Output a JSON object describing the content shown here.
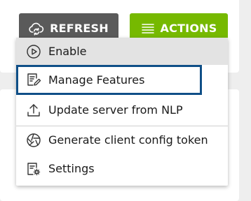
{
  "toolbar": {
    "refresh_label": "REFRESH",
    "actions_label": "ACTIONS"
  },
  "menu": {
    "items": [
      {
        "label": "Enable",
        "icon": "play-circle-icon"
      },
      {
        "label": "Manage Features",
        "icon": "edit-document-icon"
      },
      {
        "label": "Update server from NLP",
        "icon": "upload-icon"
      },
      {
        "label": "Generate client config token",
        "icon": "aperture-icon"
      },
      {
        "label": "Settings",
        "icon": "settings-document-icon"
      }
    ]
  },
  "colors": {
    "refresh_button": "#5a5a5a",
    "actions_button": "#76b900",
    "highlight_border": "#0f4f87",
    "hover_background": "#e3e3e3"
  }
}
